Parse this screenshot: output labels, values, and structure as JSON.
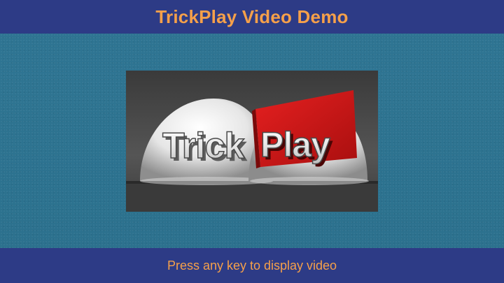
{
  "header": {
    "title": "TrickPlay Video Demo"
  },
  "video": {
    "logo_icon": "trickplay-logo",
    "logo_text_left": "Trick",
    "logo_text_right": "Play"
  },
  "footer": {
    "prompt": "Press any key to display video"
  },
  "colors": {
    "bar_background": "#2d3b86",
    "accent_text": "#f5a04a",
    "screen_background": "#2e7490",
    "logo_red": "#d71e1e"
  }
}
